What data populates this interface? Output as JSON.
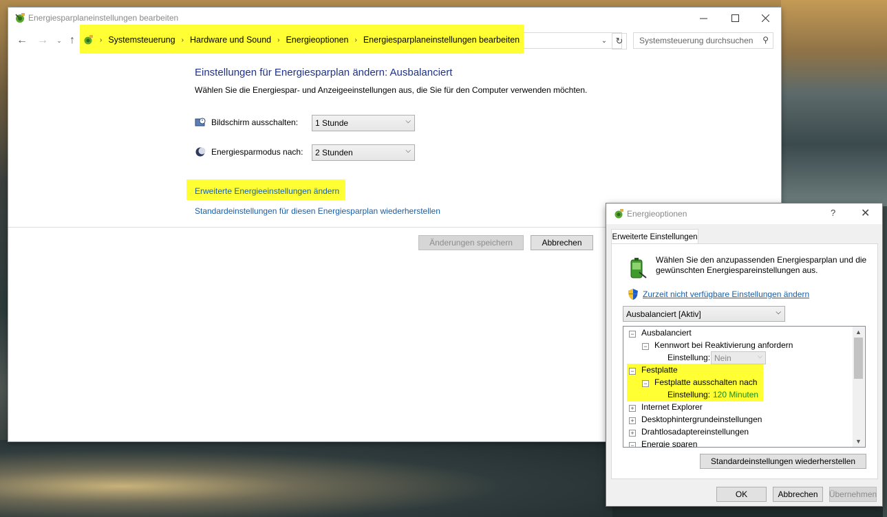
{
  "main_window": {
    "title": "Energiesparplaneinstellungen bearbeiten",
    "breadcrumbs": [
      "Systemsteuerung",
      "Hardware und Sound",
      "Energieoptionen",
      "Energiesparplaneinstellungen bearbeiten"
    ],
    "search_placeholder": "Systemsteuerung durchsuchen",
    "heading": "Einstellungen für Energiesparplan ändern: Ausbalanciert",
    "subheading": "Wählen Sie die Energiespar- und Anzeigeeinstellungen aus, die Sie für den Computer verwenden möchten.",
    "display_off_label": "Bildschirm ausschalten:",
    "display_off_value": "1 Stunde",
    "sleep_label": "Energiesparmodus nach:",
    "sleep_value": "2 Stunden",
    "advanced_link": "Erweiterte Energieeinstellungen ändern",
    "restore_link": "Standardeinstellungen für diesen Energiesparplan wiederherstellen",
    "save_button": "Änderungen speichern",
    "cancel_button": "Abbrechen"
  },
  "dialog": {
    "title": "Energieoptionen",
    "help": "?",
    "close": "✕",
    "tab": "Erweiterte Einstellungen",
    "intro": "Wählen Sie den anzupassenden Energiesparplan und die gewünschten Energiespareinstellungen aus.",
    "unavailable_link": "Zurzeit nicht verfügbare Einstellungen ändern",
    "plan_value": "Ausbalanciert [Aktiv]",
    "tree": {
      "n1": "Ausbalanciert",
      "n2": "Kennwort bei Reaktivierung anfordern",
      "n3_label": "Einstellung:",
      "n3_value": "Nein",
      "n4": "Festplatte",
      "n5": "Festplatte ausschalten nach",
      "n6_label": "Einstellung:",
      "n6_value": "120 Minuten",
      "n7": "Internet Explorer",
      "n8": "Desktophintergrundeinstellungen",
      "n9": "Drahtlosadaptereinstellungen",
      "n10": "Energie sparen"
    },
    "restore_button": "Standardeinstellungen wiederherstellen",
    "ok_button": "OK",
    "cancel_button": "Abbrechen",
    "apply_button": "Übernehmen"
  },
  "colors": {
    "highlight": "#ffff33",
    "heading": "#1e3287",
    "link": "#1a5ea5",
    "tree_value": "#1a8a1a"
  }
}
